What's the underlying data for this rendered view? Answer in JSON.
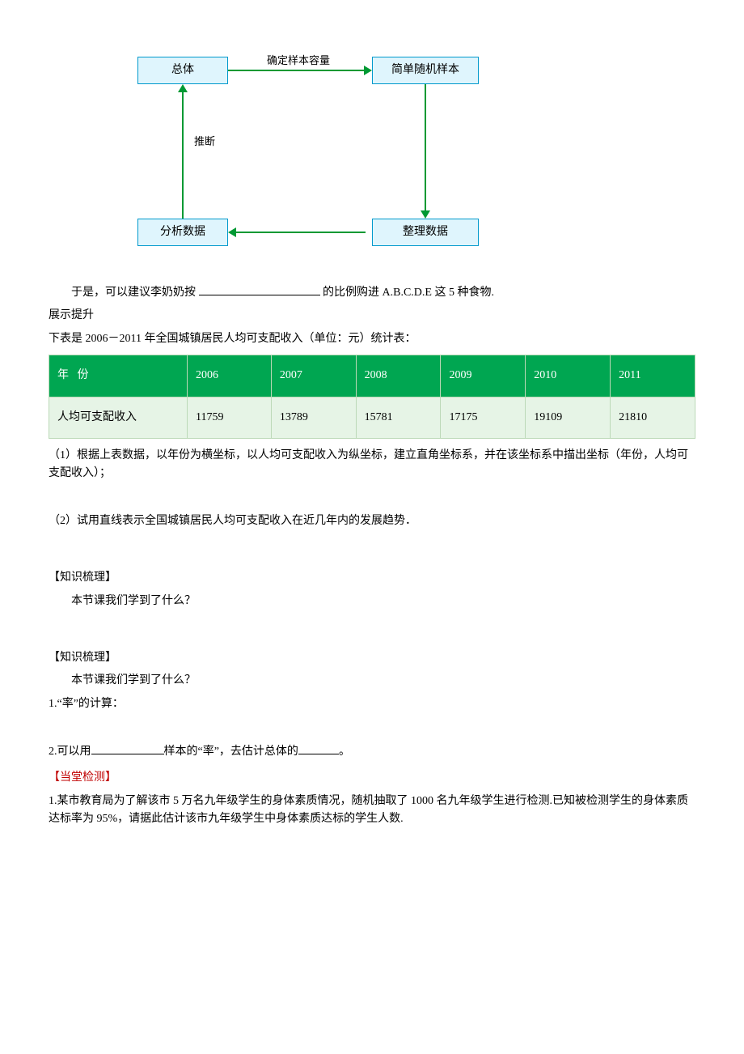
{
  "flowchart": {
    "zongti": "总体",
    "jiandan": "简单随机样本",
    "fenxi": "分析数据",
    "zhengli": "整理数据",
    "label_top": "确定样本容量",
    "label_left": "推断"
  },
  "suggestion": {
    "prefix": "于是，可以建议李奶奶按 ",
    "suffix": " 的比例购进 A.B.C.D.E 这 5 种食物."
  },
  "section_show": "展示提升",
  "table_intro": "下表是 2006－2011 年全国城镇居民人均可支配收入（单位：元）统计表：",
  "chart_data": {
    "type": "table",
    "row_labels": {
      "year": "年        份",
      "income": "人均可支配收入"
    },
    "categories": [
      "2006",
      "2007",
      "2008",
      "2009",
      "2010",
      "2011"
    ],
    "values": [
      11759,
      13789,
      15781,
      17175,
      19109,
      21810
    ],
    "title": "2006－2011 年全国城镇居民人均可支配收入（单位：元）统计表",
    "xlabel": "年份",
    "ylabel": "人均可支配收入"
  },
  "q1": "（1）根据上表数据，以年份为横坐标，以人均可支配收入为纵坐标，建立直角坐标系，并在该坐标系中描出坐标（年份，人均可支配收入）；",
  "q2": "（2）试用直线表示全国城镇居民人均可支配收入在近几年内的发展趋势．",
  "knowledge": {
    "title": "【知识梳理】",
    "body": "本节课我们学到了什么？"
  },
  "item1": "1.“率”的计算：",
  "item2": {
    "pre": "2.可以用",
    "mid": "样本的“率”，去估计总体的",
    "post": "。"
  },
  "exam": {
    "title": "【当堂检测】",
    "q": "1.某市教育局为了解该市 5 万名九年级学生的身体素质情况，随机抽取了 1000 名九年级学生进行检测.已知被检测学生的身体素质达标率为 95%，请据此估计该市九年级学生中身体素质达标的学生人数."
  }
}
